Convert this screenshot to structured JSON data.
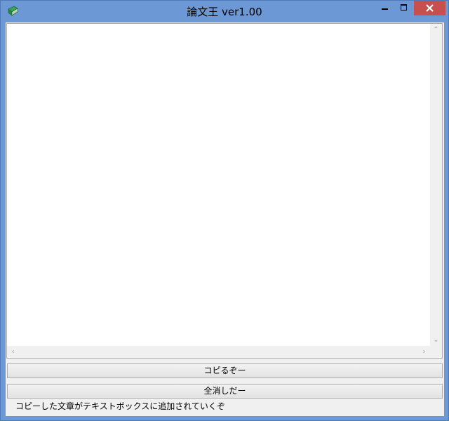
{
  "window": {
    "title": "論文王 ver1.00",
    "icon": "green-book-icon",
    "colors": {
      "frame": "#6c98d6",
      "close_button": "#c7504f",
      "client_background": "#f0f0f0"
    },
    "controls": {
      "minimize_icon": "minimize-icon",
      "maximize_icon": "maximize-icon",
      "close_icon": "close-icon"
    }
  },
  "text_area": {
    "value": "",
    "scroll_icons": {
      "up": "chevron-up-icon",
      "down": "chevron-down-icon",
      "left": "chevron-left-icon",
      "right": "chevron-right-icon"
    }
  },
  "buttons": {
    "copy_label": "コピるぞー",
    "clear_label": "全消しだー"
  },
  "status": {
    "text": "コピーした文章がテキストボックスに追加されていくぞ"
  }
}
